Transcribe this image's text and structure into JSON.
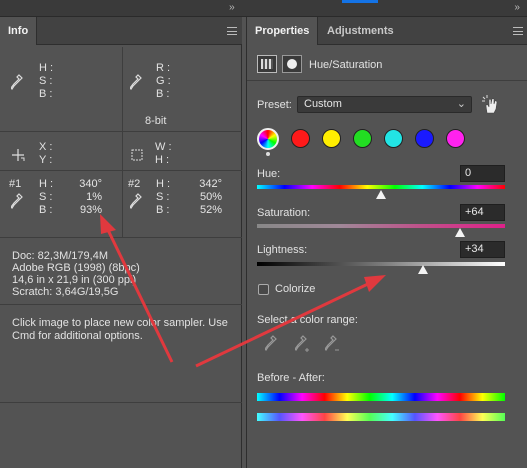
{
  "info": {
    "tab": "Info",
    "sampler1": {
      "H": "H :",
      "S": "S :",
      "B": "B :"
    },
    "sampler2": {
      "R": "R :",
      "G": "G :",
      "B": "B :",
      "depth": "8-bit"
    },
    "coords": {
      "X": "X :",
      "Y": "Y :",
      "W": "W :",
      "H": "H :"
    },
    "point1": {
      "id": "#1",
      "H": "340°",
      "S": "1%",
      "B": "93%"
    },
    "point2": {
      "id": "#2",
      "H": "342°",
      "S": "50%",
      "B": "52%"
    },
    "doc_lines": [
      "Doc: 82,3M/179,4M",
      "Adobe RGB (1998) (8bpc)",
      "14,6 in x 21,9 in (300 ppi)",
      "Scratch: 3,64G/19,5G"
    ],
    "hint_lines": [
      "Click image to place new color sampler.  Use",
      "Cmd for additional options."
    ]
  },
  "properties": {
    "tab_properties": "Properties",
    "tab_adjustments": "Adjustments",
    "title": "Hue/Saturation",
    "preset_label": "Preset:",
    "preset_value": "Custom",
    "hue_label": "Hue:",
    "hue_value": "0",
    "hue_level": 0.5,
    "saturation_label": "Saturation:",
    "saturation_value": "+64",
    "saturation_level": 0.82,
    "lightness_label": "Lightness:",
    "lightness_value": "+34",
    "lightness_level": 0.67,
    "colorize_label": "Colorize",
    "range_label": "Select a color range:",
    "before_after_label": "Before - After:",
    "swatches": [
      "#ff1a1a",
      "#ffee00",
      "#22dd22",
      "#22e5e5",
      "#1a1aff",
      "#ff22ee"
    ]
  },
  "colors": {
    "arrow": "#e0393e",
    "accent": "#1473e6"
  }
}
